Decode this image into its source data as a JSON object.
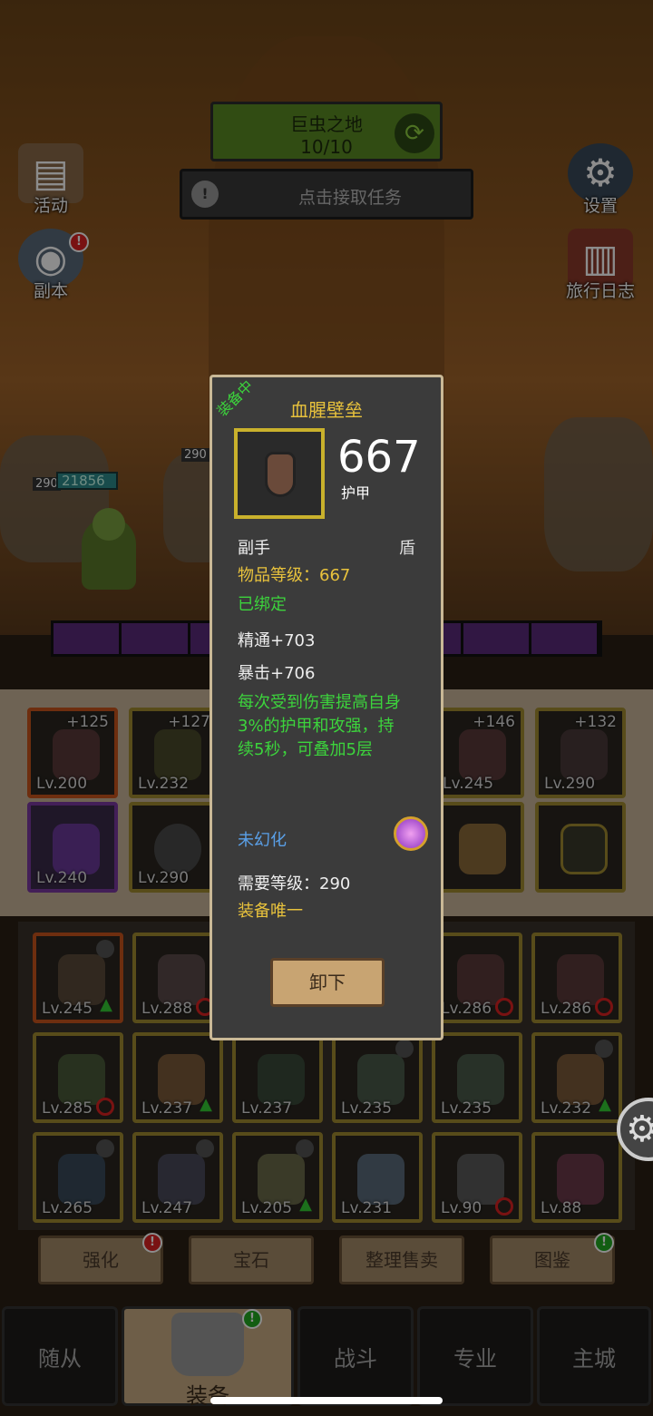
{
  "zone": {
    "name": "巨虫之地",
    "progress": "10/10"
  },
  "quest": {
    "text": "点击接取任务"
  },
  "side_buttons": {
    "activity": "活动",
    "dungeon": "副本",
    "settings": "设置",
    "travel_log": "旅行日志"
  },
  "hud": {
    "level_a": "290",
    "level_b": "290",
    "hp": "21856"
  },
  "equip_slots": [
    {
      "lv": "Lv.200",
      "plus": "+125"
    },
    {
      "lv": "Lv.232",
      "plus": "+127"
    },
    {
      "lv": "Lv.245",
      "plus": "+146"
    },
    {
      "lv": "Lv.290",
      "plus": "+132"
    },
    {
      "lv": "Lv.240",
      "plus": ""
    },
    {
      "lv": "Lv.290",
      "plus": ""
    }
  ],
  "inventory": [
    {
      "lv": "Lv.245",
      "mark": "up"
    },
    {
      "lv": "Lv.288",
      "mark": "no"
    },
    {
      "lv": "Lv.286",
      "mark": "no"
    },
    {
      "lv": "Lv.286",
      "mark": "no"
    },
    {
      "lv": "Lv.285",
      "mark": "no"
    },
    {
      "lv": "Lv.237",
      "mark": "up"
    },
    {
      "lv": "Lv.237",
      "mark": ""
    },
    {
      "lv": "Lv.235",
      "mark": ""
    },
    {
      "lv": "Lv.235",
      "mark": ""
    },
    {
      "lv": "Lv.232",
      "mark": "up"
    },
    {
      "lv": "Lv.265",
      "mark": ""
    },
    {
      "lv": "Lv.247",
      "mark": ""
    },
    {
      "lv": "Lv.205",
      "mark": "up"
    },
    {
      "lv": "Lv.231",
      "mark": ""
    },
    {
      "lv": "Lv.90",
      "mark": "no"
    },
    {
      "lv": "Lv.88",
      "mark": ""
    }
  ],
  "tools": {
    "enhance": "强化",
    "gems": "宝石",
    "sort_sell": "整理售卖",
    "codex": "图鉴"
  },
  "tabs": {
    "followers": "随从",
    "equipment": "装备",
    "battle": "战斗",
    "profession": "专业",
    "main_city": "主城"
  },
  "tooltip": {
    "equipped_tag": "装备中",
    "name": "血腥壁垒",
    "item_level_big": "667",
    "stat_label": "护甲",
    "slot": "副手",
    "type": "盾",
    "item_level_line": "物品等级：667",
    "bound": "已绑定",
    "stat1": "精通+703",
    "stat2": "暴击+706",
    "effect": "每次受到伤害提高自身3%的护甲和攻强，持续5秒，可叠加5层",
    "transmog": "未幻化",
    "req_level": "需要等级：290",
    "unique": "装备唯一",
    "unequip_button": "卸下"
  },
  "colors": {
    "accent_green": "#3cd43c",
    "gold": "#e8c23c",
    "blue": "#5aa0e8",
    "alert_red": "#dd2222"
  }
}
